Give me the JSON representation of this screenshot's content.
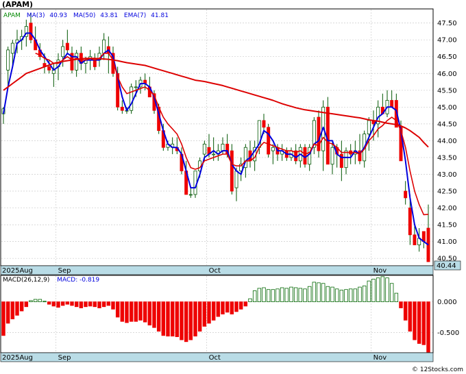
{
  "title": "(APAM)",
  "colors": {
    "up": "#ffffff",
    "down": "#ee0000",
    "candle_edge": "#005500",
    "ma3": "#0000dd",
    "ma50": "#dd0000",
    "ema7": "#dd0000",
    "macd_pos_edge": "#006600",
    "macd_neg": "#ee0000",
    "band": "#b9dce6",
    "grid": "#cccccc"
  },
  "price_panel": {
    "legend": {
      "symbol": "APAM",
      "ma3_label": "MA(3)",
      "ma3_value": "40.93",
      "ma50_label": "MA(50)",
      "ma50_value": "43.81",
      "ema7_label": "EMA(7)",
      "ema7_value": "41.81"
    },
    "last_price": "40.44",
    "yticks": [
      "40.50",
      "41.00",
      "41.50",
      "42.00",
      "42.50",
      "43.00",
      "43.50",
      "44.00",
      "44.50",
      "45.00",
      "45.50",
      "46.00",
      "46.50",
      "47.00",
      "47.50"
    ],
    "month_labels": [
      "2025Aug",
      "Sep",
      "Oct",
      "Nov"
    ]
  },
  "macd_panel": {
    "legend": {
      "label": "MACD(26,12,9)",
      "macd_label": "MACD:",
      "macd_value": "-0.819"
    },
    "yticks": [
      "0.000",
      "-0.500"
    ],
    "month_labels": [
      "2025Aug",
      "Sep",
      "Oct",
      "Nov"
    ]
  },
  "watermark": "© 12Stocks.com",
  "chart_data": [
    {
      "type": "candlestick",
      "title": "(APAM)",
      "ylim": [
        40.3,
        47.9
      ],
      "x_month_ticks": [
        {
          "label": "2025Aug",
          "index": 0
        },
        {
          "label": "Sep",
          "index": 12
        },
        {
          "label": "Oct",
          "index": 45
        },
        {
          "label": "Nov",
          "index": 81
        }
      ],
      "ohlc": [
        [
          44.8,
          45.0,
          44.5,
          44.95
        ],
        [
          46.1,
          46.8,
          45.6,
          46.7
        ],
        [
          46.6,
          47.0,
          46.2,
          46.9
        ],
        [
          46.9,
          47.3,
          46.6,
          47.0
        ],
        [
          47.0,
          47.3,
          46.7,
          47.1
        ],
        [
          47.1,
          47.6,
          46.8,
          47.4
        ],
        [
          47.5,
          47.8,
          46.9,
          47.0
        ],
        [
          47.0,
          47.4,
          46.7,
          46.7
        ],
        [
          46.7,
          46.9,
          46.4,
          46.5
        ],
        [
          46.3,
          46.6,
          46.0,
          46.2
        ],
        [
          46.2,
          46.4,
          46.0,
          46.1
        ],
        [
          46.0,
          46.3,
          45.6,
          46.1
        ],
        [
          46.2,
          46.6,
          45.8,
          46.4
        ],
        [
          46.5,
          47.0,
          46.2,
          46.8
        ],
        [
          46.9,
          47.3,
          46.6,
          46.7
        ],
        [
          46.6,
          46.8,
          46.0,
          46.1
        ],
        [
          46.1,
          46.7,
          45.9,
          46.6
        ],
        [
          46.6,
          46.8,
          46.1,
          46.3
        ],
        [
          46.3,
          46.5,
          46.0,
          46.4
        ],
        [
          46.4,
          46.7,
          46.1,
          46.5
        ],
        [
          46.4,
          46.6,
          46.1,
          46.2
        ],
        [
          46.4,
          46.8,
          46.2,
          46.6
        ],
        [
          46.6,
          47.2,
          46.4,
          47.0
        ],
        [
          46.8,
          47.1,
          46.0,
          46.6
        ],
        [
          46.6,
          46.8,
          45.9,
          46.0
        ],
        [
          46.0,
          46.2,
          44.9,
          45.0
        ],
        [
          45.0,
          45.2,
          44.8,
          44.9
        ],
        [
          44.9,
          45.0,
          44.8,
          44.9
        ],
        [
          44.9,
          45.7,
          44.8,
          45.6
        ],
        [
          45.6,
          45.8,
          45.3,
          45.6
        ],
        [
          45.6,
          45.9,
          45.4,
          45.8
        ],
        [
          45.8,
          46.0,
          45.5,
          45.7
        ],
        [
          45.6,
          45.9,
          45.3,
          45.3
        ],
        [
          45.4,
          45.5,
          44.8,
          44.9
        ],
        [
          45.0,
          45.1,
          44.2,
          44.3
        ],
        [
          44.3,
          44.5,
          43.7,
          43.8
        ],
        [
          43.8,
          44.0,
          43.7,
          43.9
        ],
        [
          43.8,
          44.1,
          43.6,
          43.9
        ],
        [
          43.8,
          44.1,
          43.6,
          43.7
        ],
        [
          43.6,
          43.8,
          43.0,
          43.1
        ],
        [
          43.1,
          43.4,
          42.4,
          42.4
        ],
        [
          42.4,
          42.6,
          42.3,
          42.4
        ],
        [
          42.4,
          43.1,
          42.3,
          43.1
        ],
        [
          43.1,
          43.5,
          42.9,
          43.4
        ],
        [
          43.6,
          44.0,
          43.4,
          43.9
        ],
        [
          43.8,
          44.2,
          43.5,
          43.6
        ],
        [
          43.6,
          44.1,
          43.4,
          43.6
        ],
        [
          43.6,
          43.9,
          43.4,
          43.7
        ],
        [
          43.7,
          44.1,
          43.6,
          43.9
        ],
        [
          43.9,
          44.2,
          43.5,
          43.6
        ],
        [
          43.7,
          43.9,
          42.4,
          42.5
        ],
        [
          42.6,
          43.2,
          42.2,
          43.1
        ],
        [
          43.1,
          43.5,
          42.8,
          43.3
        ],
        [
          43.2,
          43.9,
          42.9,
          43.8
        ],
        [
          43.7,
          44.0,
          43.2,
          43.4
        ],
        [
          43.4,
          44.0,
          43.1,
          43.8
        ],
        [
          43.8,
          44.6,
          43.6,
          44.6
        ],
        [
          44.6,
          44.8,
          44.2,
          44.4
        ],
        [
          44.4,
          44.5,
          43.5,
          43.6
        ],
        [
          43.7,
          43.9,
          43.3,
          43.8
        ],
        [
          43.8,
          43.9,
          43.4,
          43.6
        ],
        [
          43.6,
          43.9,
          43.4,
          43.7
        ],
        [
          43.7,
          43.8,
          43.4,
          43.5
        ],
        [
          43.5,
          43.8,
          43.4,
          43.7
        ],
        [
          43.7,
          43.9,
          43.3,
          43.4
        ],
        [
          43.4,
          43.9,
          43.2,
          43.8
        ],
        [
          43.8,
          43.9,
          43.2,
          43.3
        ],
        [
          43.3,
          43.9,
          43.1,
          43.8
        ],
        [
          43.8,
          44.7,
          43.6,
          44.6
        ],
        [
          44.7,
          44.9,
          43.5,
          43.7
        ],
        [
          43.7,
          45.2,
          43.1,
          45.0
        ],
        [
          45.0,
          45.3,
          43.4,
          43.3
        ],
        [
          43.3,
          44.0,
          43.0,
          43.8
        ],
        [
          43.8,
          43.9,
          43.2,
          43.6
        ],
        [
          43.6,
          44.0,
          42.8,
          43.2
        ],
        [
          43.2,
          43.8,
          43.0,
          43.7
        ],
        [
          43.7,
          43.9,
          43.3,
          43.6
        ],
        [
          43.6,
          44.0,
          43.3,
          43.7
        ],
        [
          43.7,
          44.2,
          43.3,
          43.4
        ],
        [
          43.4,
          44.3,
          43.2,
          44.2
        ],
        [
          44.2,
          44.7,
          43.7,
          44.6
        ],
        [
          44.6,
          44.9,
          44.0,
          44.5
        ],
        [
          44.5,
          45.2,
          44.1,
          45.0
        ],
        [
          45.0,
          45.4,
          44.8,
          44.8
        ],
        [
          44.8,
          45.5,
          44.7,
          45.2
        ],
        [
          45.2,
          45.5,
          45.0,
          45.0
        ],
        [
          45.2,
          45.4,
          44.5,
          44.4
        ],
        [
          44.4,
          44.6,
          43.4,
          43.4
        ],
        [
          42.5,
          42.8,
          42.1,
          42.3
        ],
        [
          42.0,
          42.4,
          40.9,
          41.2
        ],
        [
          41.2,
          41.5,
          40.9,
          40.9
        ],
        [
          40.9,
          41.4,
          40.7,
          41.1
        ],
        [
          41.3,
          41.3,
          40.8,
          41.0
        ],
        [
          41.4,
          42.1,
          40.4,
          40.4
        ]
      ],
      "series": [
        {
          "name": "MA(3)",
          "values": [
            44.8,
            45.6,
            46.2,
            46.9,
            47.0,
            47.2,
            47.2,
            47.0,
            46.7,
            46.5,
            46.3,
            46.1,
            46.2,
            46.4,
            46.6,
            46.5,
            46.5,
            46.3,
            46.4,
            46.4,
            46.4,
            46.4,
            46.6,
            46.7,
            46.5,
            45.9,
            45.3,
            44.9,
            45.1,
            45.4,
            45.7,
            45.7,
            45.6,
            45.3,
            44.8,
            44.3,
            43.9,
            43.8,
            43.8,
            43.6,
            43.1,
            42.6,
            42.6,
            43.0,
            43.5,
            43.6,
            43.7,
            43.6,
            43.7,
            43.7,
            43.3,
            43.1,
            43.0,
            43.4,
            43.5,
            43.7,
            43.9,
            44.3,
            44.2,
            44.0,
            43.7,
            43.7,
            43.6,
            43.6,
            43.5,
            43.6,
            43.5,
            43.6,
            43.9,
            44.0,
            44.4,
            44.0,
            44.0,
            43.6,
            43.5,
            43.5,
            43.5,
            43.7,
            43.6,
            43.8,
            44.1,
            44.4,
            44.7,
            44.8,
            45.0,
            45.0,
            44.9,
            44.3,
            43.4,
            42.3,
            41.5,
            41.1,
            41.0,
            40.9
          ]
        },
        {
          "name": "MA(50)",
          "values": [
            45.5,
            45.6,
            45.7,
            45.8,
            45.9,
            46.0,
            46.05,
            46.1,
            46.15,
            46.2,
            46.25,
            46.3,
            46.33,
            46.36,
            46.38,
            46.4,
            46.42,
            46.44,
            46.45,
            46.45,
            46.45,
            46.44,
            46.43,
            46.42,
            46.4,
            46.38,
            46.35,
            46.32,
            46.3,
            46.28,
            46.26,
            46.24,
            46.2,
            46.16,
            46.12,
            46.08,
            46.04,
            46.0,
            45.96,
            45.92,
            45.88,
            45.84,
            45.8,
            45.78,
            45.76,
            45.73,
            45.7,
            45.67,
            45.64,
            45.6,
            45.56,
            45.52,
            45.48,
            45.44,
            45.4,
            45.36,
            45.32,
            45.28,
            45.24,
            45.2,
            45.15,
            45.1,
            45.06,
            45.02,
            44.98,
            44.95,
            44.92,
            44.9,
            44.88,
            44.86,
            44.84,
            44.82,
            44.8,
            44.78,
            44.76,
            44.74,
            44.72,
            44.7,
            44.68,
            44.65,
            44.62,
            44.6,
            44.58,
            44.55,
            44.52,
            44.5,
            44.48,
            44.44,
            44.38,
            44.3,
            44.2,
            44.1,
            43.95,
            43.81
          ]
        },
        {
          "name": "EMA(7)",
          "values": [
            null,
            null,
            null,
            null,
            null,
            null,
            null,
            46.6,
            46.55,
            46.45,
            46.4,
            46.3,
            46.3,
            46.4,
            46.5,
            46.4,
            46.45,
            46.4,
            46.4,
            46.45,
            46.4,
            46.45,
            46.6,
            46.6,
            46.4,
            45.9,
            45.6,
            45.4,
            45.45,
            45.5,
            45.55,
            45.6,
            45.5,
            45.35,
            45.0,
            44.7,
            44.5,
            44.35,
            44.2,
            43.9,
            43.5,
            43.2,
            43.15,
            43.2,
            43.4,
            43.45,
            43.5,
            43.55,
            43.6,
            43.6,
            43.3,
            43.25,
            43.25,
            43.4,
            43.4,
            43.5,
            43.8,
            43.95,
            43.9,
            43.85,
            43.8,
            43.75,
            43.7,
            43.7,
            43.65,
            43.7,
            43.6,
            43.65,
            43.9,
            43.85,
            44.1,
            43.95,
            43.9,
            43.8,
            43.65,
            43.65,
            43.65,
            43.65,
            43.6,
            43.75,
            44.0,
            44.15,
            44.35,
            44.45,
            44.6,
            44.7,
            44.6,
            44.3,
            43.8,
            43.1,
            42.5,
            42.1,
            41.8,
            41.81
          ]
        }
      ]
    },
    {
      "type": "bar",
      "title": "MACD(26,12,9)",
      "ylim": [
        -0.82,
        0.42
      ],
      "series": [
        {
          "name": "MACD",
          "values": [
            -0.55,
            -0.35,
            -0.28,
            -0.22,
            -0.15,
            -0.08,
            0.02,
            0.04,
            0.04,
            0.01,
            -0.04,
            -0.07,
            -0.09,
            -0.06,
            -0.04,
            -0.06,
            -0.08,
            -0.1,
            -0.08,
            -0.07,
            -0.08,
            -0.1,
            -0.08,
            -0.06,
            -0.12,
            -0.25,
            -0.32,
            -0.34,
            -0.32,
            -0.32,
            -0.3,
            -0.33,
            -0.38,
            -0.42,
            -0.48,
            -0.55,
            -0.56,
            -0.56,
            -0.57,
            -0.62,
            -0.65,
            -0.62,
            -0.56,
            -0.48,
            -0.4,
            -0.35,
            -0.3,
            -0.24,
            -0.2,
            -0.17,
            -0.2,
            -0.16,
            -0.12,
            -0.07,
            0.05,
            0.18,
            0.22,
            0.23,
            0.2,
            0.2,
            0.21,
            0.23,
            0.22,
            0.24,
            0.23,
            0.22,
            0.21,
            0.25,
            0.32,
            0.31,
            0.3,
            0.25,
            0.24,
            0.21,
            0.19,
            0.2,
            0.21,
            0.21,
            0.24,
            0.26,
            0.34,
            0.37,
            0.39,
            0.41,
            0.39,
            0.3,
            0.14,
            -0.1,
            -0.3,
            -0.48,
            -0.62,
            -0.68,
            -0.7,
            -0.82
          ]
        }
      ]
    }
  ]
}
